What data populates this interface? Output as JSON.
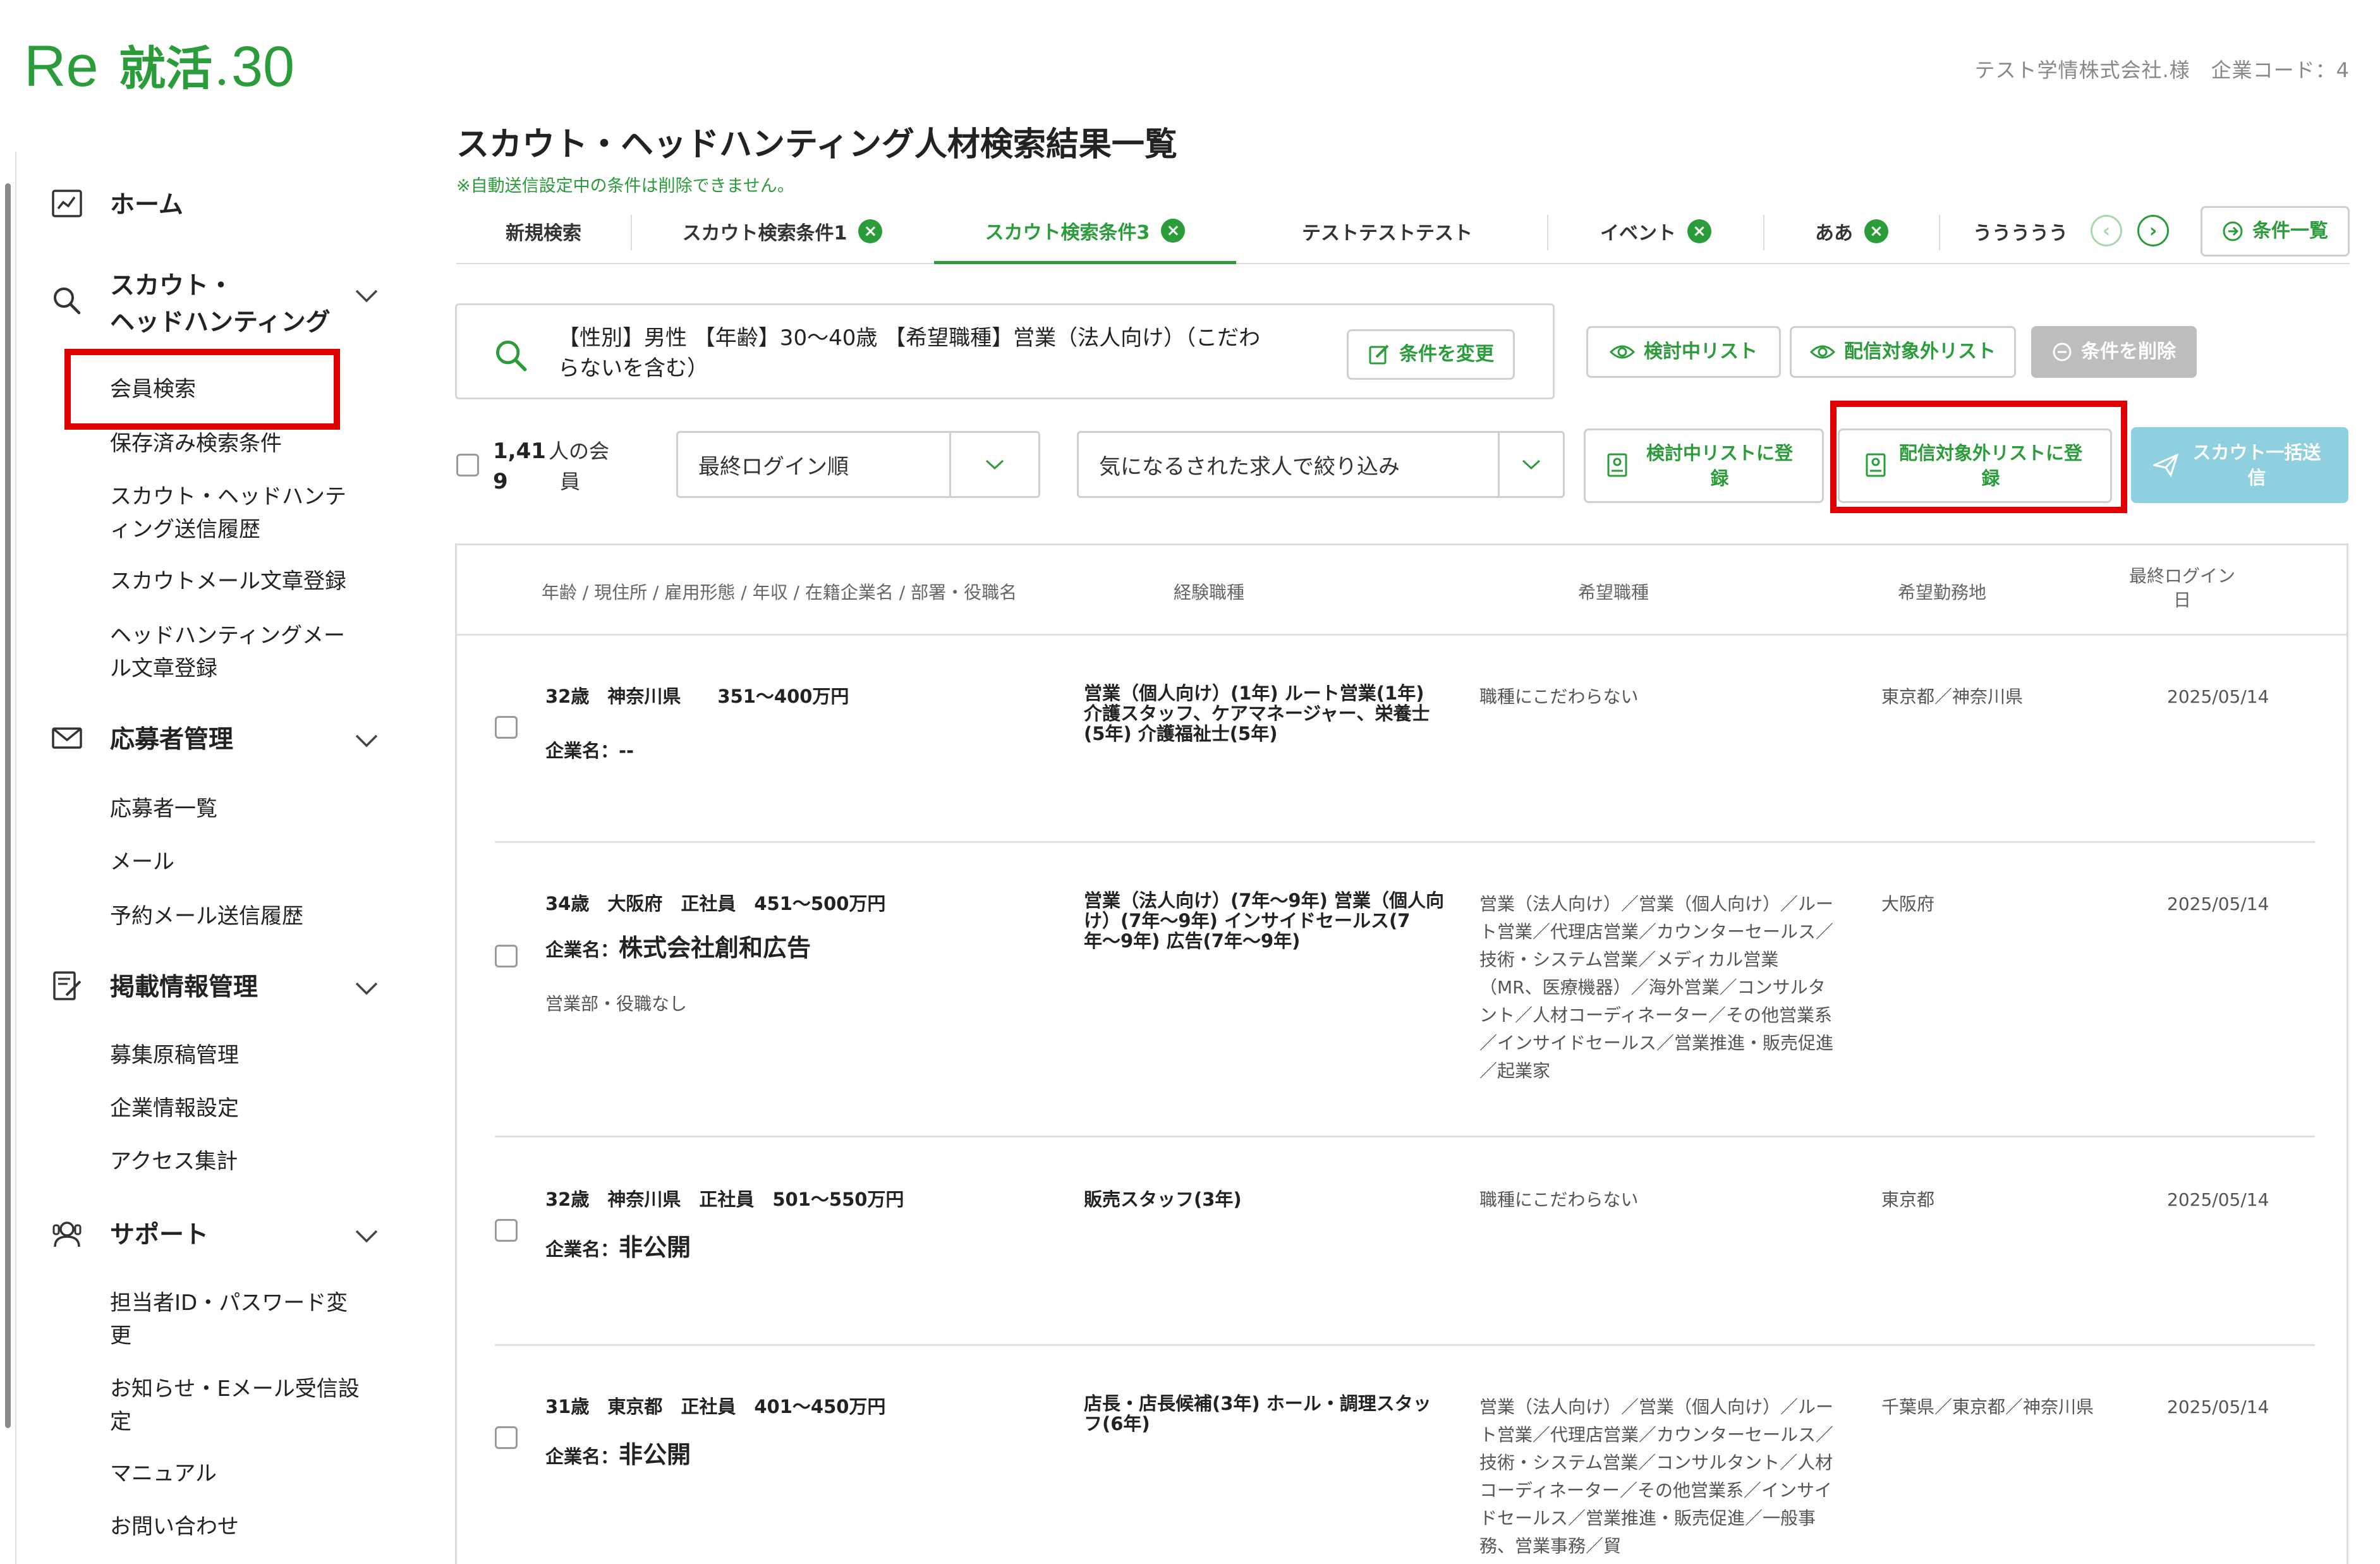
{
  "app": {
    "logo_text": "Re就活30",
    "company_info": "テスト学情株式会社.様　企業コード：4",
    "colors": {
      "brand_green": "#2a9d3a",
      "highlight_red": "#e00000",
      "disabled_gray": "#bdbdbd",
      "scout_blue": "#8fd0e0"
    }
  },
  "sidebar": {
    "home": "ホーム",
    "scout_group": {
      "label_line1": "スカウト・",
      "label_line2": "ヘッドハンティング",
      "icon": "search-icon"
    },
    "scout_items": [
      "会員検索",
      "保存済み検索条件",
      "スカウト・ヘッドハンティング送信履歴",
      "スカウトメール文章登録",
      "ヘッドハンティングメール文章登録"
    ],
    "applicant_group": {
      "label": "応募者管理",
      "icon": "mail-icon"
    },
    "applicant_items": [
      "応募者一覧",
      "メール",
      "予約メール送信履歴"
    ],
    "posting_group": {
      "label": "掲載情報管理",
      "icon": "edit-doc-icon"
    },
    "posting_items": [
      "募集原稿管理",
      "企業情報設定",
      "アクセス集計"
    ],
    "support_group": {
      "label": "サポート",
      "icon": "support-icon"
    },
    "support_items": [
      "担当者ID・パスワード変更",
      "お知らせ・Eメール受信設定",
      "マニュアル",
      "お問い合わせ"
    ]
  },
  "main": {
    "title": "スカウト・ヘッドハンティング人材検索結果一覧",
    "notice": "※自動送信設定中の条件は削除できません。",
    "tabs": [
      {
        "label": "新規検索",
        "closable": false
      },
      {
        "label": "スカウト検索条件1",
        "closable": true
      },
      {
        "label": "スカウト検索条件3",
        "closable": true,
        "active": true
      },
      {
        "label": "テストテストテスト",
        "closable": false
      },
      {
        "label": "イベント",
        "closable": true
      },
      {
        "label": "ああ",
        "closable": true
      },
      {
        "label": "ううううう",
        "closable": false
      }
    ],
    "condition_list_button": "条件一覧",
    "search_summary": "【性別】男性 【年齢】30〜40歳 【希望職種】営業（法人向け）（こだわらないを含む）",
    "change_condition_button": "条件を変更",
    "review_list_button": "検討中リスト",
    "excluded_list_button": "配信対象外リスト",
    "delete_condition_button": "条件を削除",
    "count_number_line1": "1,41",
    "count_number_line2": "9",
    "count_unit_line1": "人の会",
    "count_unit_line2": "員",
    "sort_select": "最終ログイン順",
    "filter_select": "気になるされた求人で絞り込み",
    "register_review_button": "検討中リストに登録",
    "register_excluded_button": "配信対象外リストに登録",
    "scout_bulk_button": "スカウト一括送信"
  },
  "table": {
    "headers": {
      "profile": "年齢 / 現住所 / 雇用形態 / 年収 / 在籍企業名 / 部署・役職名",
      "experience": "経験職種",
      "desired": "希望職種",
      "location": "希望勤務地",
      "last_login": "最終ログイン日"
    },
    "rows": [
      {
        "profile": "32歳　神奈川県　　351〜400万円",
        "company_label": "企業名：",
        "company": "--",
        "dept": "",
        "experience": "営業（個人向け）(1年) ルート営業(1年) 介護スタッフ、ケアマネージャー、栄養士(5年) 介護福祉士(5年)",
        "desired": "職種にこだわらない",
        "location": "東京都／神奈川県",
        "last_login": "2025/05/14"
      },
      {
        "profile": "34歳　大阪府　正社員　451〜500万円",
        "company_label": "企業名：",
        "company": "株式会社創和広告",
        "dept": "営業部・役職なし",
        "experience": "営業（法人向け）(7年〜9年) 営業（個人向け）(7年〜9年) インサイドセールス(7年〜9年) 広告(7年〜9年)",
        "desired": "営業（法人向け）／営業（個人向け）／ルート営業／代理店営業／カウンターセールス／技術・システム営業／メディカル営業（MR、医療機器）／海外営業／コンサルタント／人材コーディネーター／その他営業系／インサイドセールス／営業推進・販売促進／起業家",
        "location": "大阪府",
        "last_login": "2025/05/14"
      },
      {
        "profile": "32歳　神奈川県　正社員　501〜550万円",
        "company_label": "企業名：",
        "company": "非公開",
        "dept": "",
        "experience": "販売スタッフ(3年)",
        "desired": "職種にこだわらない",
        "location": "東京都",
        "last_login": "2025/05/14"
      },
      {
        "profile": "31歳　東京都　正社員　401〜450万円",
        "company_label": "企業名：",
        "company": "非公開",
        "dept": "",
        "experience": "店長・店長候補(3年) ホール・調理スタッフ(6年)",
        "desired": "営業（法人向け）／営業（個人向け）／ルート営業／代理店営業／カウンターセールス／技術・システム営業／コンサルタント／人材コーディネーター／その他営業系／インサイドセールス／営業推進・販売促進／一般事務、営業事務／貿",
        "location": "千葉県／東京都／神奈川県",
        "last_login": "2025/05/14"
      }
    ]
  }
}
